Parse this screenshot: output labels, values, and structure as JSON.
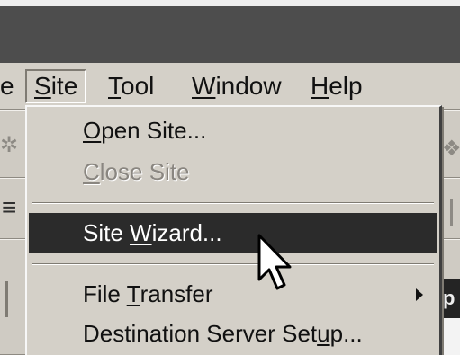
{
  "menu_bar": {
    "items": [
      {
        "label": "Site",
        "mnemonic": "S"
      },
      {
        "label": "Tool",
        "mnemonic": "T"
      },
      {
        "label": "Window",
        "mnemonic": "W"
      },
      {
        "label": "Help",
        "mnemonic": "H"
      }
    ],
    "partial_left": "e"
  },
  "toolbar": {
    "partial_right": "p"
  },
  "site_menu": {
    "items": [
      {
        "pre": "",
        "mnemonic": "O",
        "post": "pen Site...",
        "state": "enabled"
      },
      {
        "pre": "",
        "mnemonic": "C",
        "post": "lose Site",
        "state": "disabled"
      },
      {
        "pre": "Site ",
        "mnemonic": "W",
        "post": "izard...",
        "state": "highlighted"
      },
      {
        "pre": "File ",
        "mnemonic": "T",
        "post": "ransfer",
        "state": "enabled",
        "submenu": true
      },
      {
        "pre": "Destination Server Set",
        "mnemonic": "u",
        "post": "p...",
        "state": "enabled"
      }
    ]
  },
  "colors": {
    "highlight_bg": "#2b2b2b",
    "menu_bg": "#d4d0c8",
    "title_bar": "#4d4d4d"
  },
  "icons": [
    "submenu-arrow-icon",
    "mouse-pointer-icon"
  ]
}
